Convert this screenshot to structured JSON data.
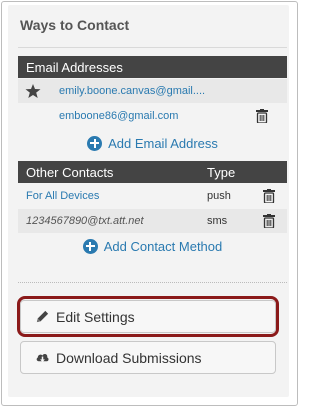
{
  "panel": {
    "title": "Ways to Contact"
  },
  "email_section": {
    "header": "Email Addresses",
    "rows": [
      {
        "address": "emily.boone.canvas@gmail....",
        "default": true,
        "star_icon": "star-icon"
      },
      {
        "address": "emboone86@gmail.com",
        "default": false,
        "delete_icon": "trash-icon"
      }
    ],
    "add_label": "Add Email Address"
  },
  "other_contacts": {
    "columns": [
      "Other Contacts",
      "Type"
    ],
    "rows": [
      {
        "name": "For All Devices",
        "type": "push",
        "delete_icon": "trash-icon"
      },
      {
        "name": "1234567890@txt.att.net",
        "type": "sms",
        "delete_icon": "trash-icon"
      }
    ],
    "add_label": "Add Contact Method"
  },
  "actions": {
    "edit_settings": "Edit Settings",
    "download_submissions": "Download Submissions"
  },
  "colors": {
    "link": "#2a7ab0",
    "header_bg": "#444444",
    "highlight_border": "#8b1a1a"
  }
}
